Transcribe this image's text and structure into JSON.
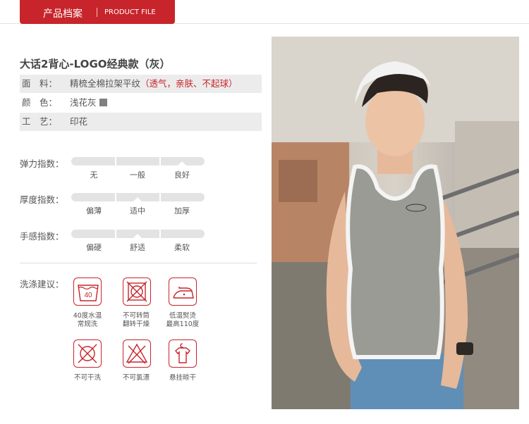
{
  "header": {
    "title_cn": "产品档案",
    "title_en": "PRODUCT FILE"
  },
  "product": {
    "title": "大话2背心-LOGO经典款（灰）",
    "rows": [
      {
        "label": "面　料：",
        "value": "精梳全棉拉架平纹",
        "highlight": "（透气，亲肤、不起球）"
      },
      {
        "label": "颜　色：",
        "value": "浅花灰",
        "swatch": "#808080"
      },
      {
        "label": "工　艺：",
        "value": "印花"
      }
    ]
  },
  "indices": [
    {
      "label": "弹力指数：",
      "options": [
        "无",
        "一般",
        "良好"
      ],
      "selected_index": 2
    },
    {
      "label": "厚度指数：",
      "options": [
        "偏薄",
        "适中",
        "加厚"
      ],
      "selected_index": 1
    },
    {
      "label": "手感指数：",
      "options": [
        "偏硬",
        "舒适",
        "柔软"
      ],
      "selected_index": 1
    }
  ],
  "wash": {
    "label": "洗涤建议：",
    "items": [
      {
        "icon": "wash-40-icon",
        "text": "40",
        "caption_line1": "40度水温",
        "caption_line2": "常规洗"
      },
      {
        "icon": "no-tumble-dry-icon",
        "caption_line1": "不可转筒",
        "caption_line2": "翻转干燥"
      },
      {
        "icon": "iron-low-icon",
        "caption_line1": "低温熨烫",
        "caption_line2": "最高110度"
      },
      {
        "icon": "no-dry-clean-icon",
        "caption_line1": "不可干洗",
        "caption_line2": ""
      },
      {
        "icon": "no-bleach-icon",
        "caption_line1": "不可氯漂",
        "caption_line2": ""
      },
      {
        "icon": "hang-dry-icon",
        "caption_line1": "悬挂晾干",
        "caption_line2": ""
      }
    ]
  },
  "colors": {
    "accent": "#c7252b",
    "swatch": "#808080"
  }
}
